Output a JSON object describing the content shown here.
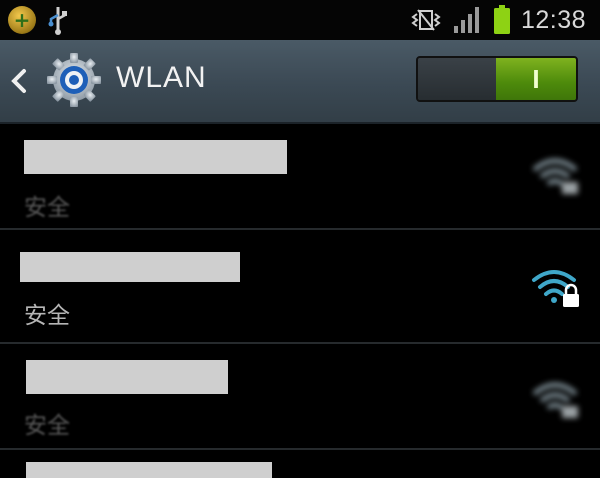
{
  "statusbar": {
    "time": "12:38",
    "icons": [
      "app-notification-icon",
      "usb-icon",
      "vibrate-icon",
      "signal-icon",
      "battery-icon"
    ],
    "battery_color": "#8ed214"
  },
  "actionbar": {
    "title": "WLAN",
    "toggle_label": "I",
    "toggle_state": "on",
    "accent_color": "#6aa317"
  },
  "networks": [
    {
      "security": "安全",
      "icon": "wifi-lock-icon",
      "blurred": true
    },
    {
      "security": "安全",
      "icon": "wifi-lock-icon",
      "blurred": false
    },
    {
      "security": "安全",
      "icon": "wifi-lock-icon",
      "blurred": true
    }
  ]
}
